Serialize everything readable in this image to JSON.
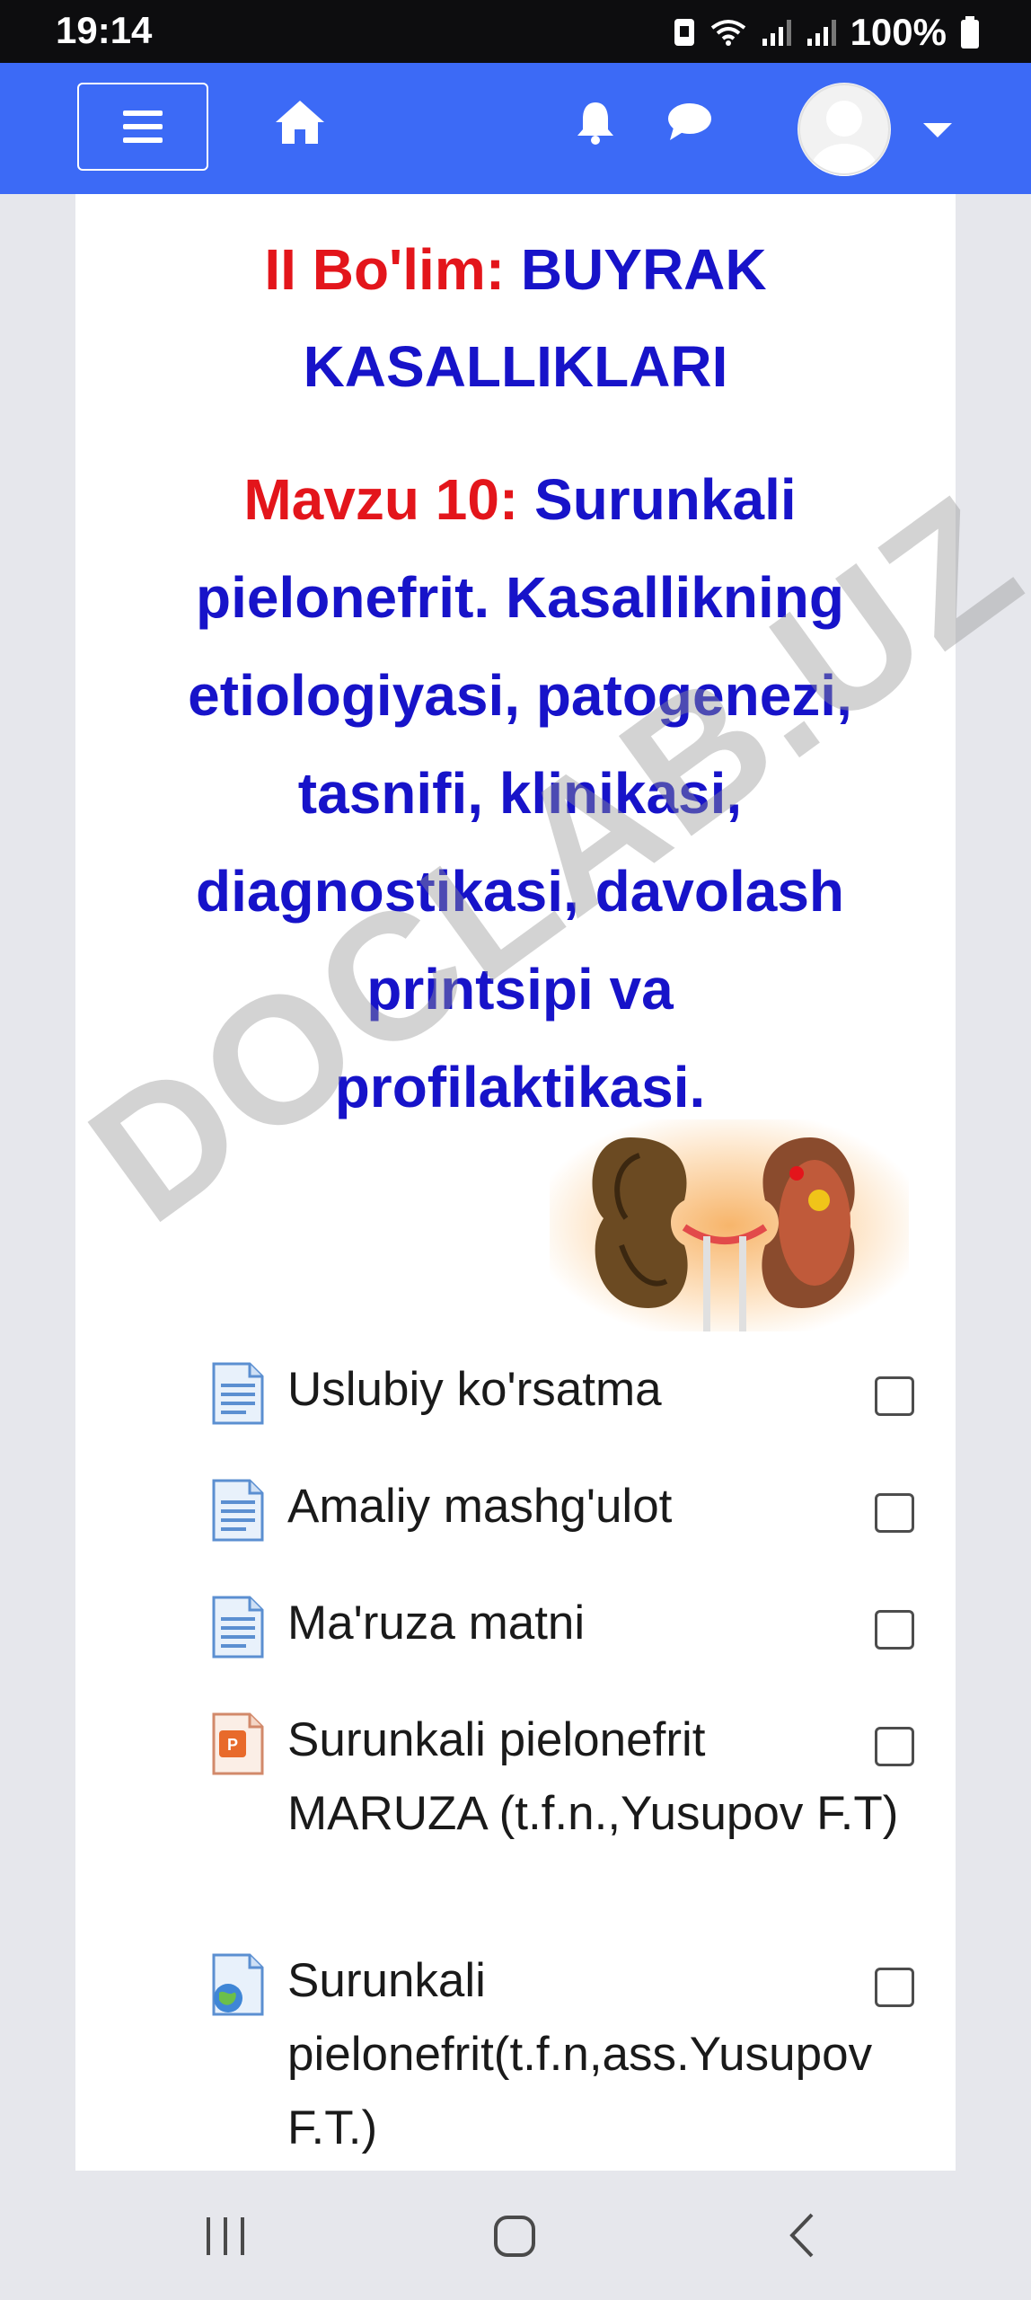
{
  "status_bar": {
    "time": "19:14",
    "battery": "100%"
  },
  "nav": {
    "menu_icon": "hamburger-icon",
    "home_icon": "home-icon",
    "notifications_icon": "bell-icon",
    "messages_icon": "chat-icon",
    "user_icon": "avatar",
    "dropdown_icon": "caret-down-icon",
    "bar_color": "#3c6af6"
  },
  "section": {
    "prefix": "II Bo'lim:",
    "title": "BUYRAK KASALLIKLARI"
  },
  "topic": {
    "prefix": "Mavzu 10:",
    "title": "Surunkali pielonefrit.  Kasallikning etiologiyasi, patogenezi, tasnifi, klinikasi, diagnostikasi, davolash printsipi va profilaktikasi."
  },
  "colors": {
    "accent_red": "#e3151b",
    "accent_blue": "#1713c9"
  },
  "resources": [
    {
      "label": "Uslubiy ko'rsatma",
      "icon": "document-icon"
    },
    {
      "label": "Amaliy mashg'ulot",
      "icon": "document-icon"
    },
    {
      "label": "Ma'ruza matni",
      "icon": "document-icon"
    },
    {
      "label": "Surunkali pielonefrit MARUZA (t.f.n.,Yusupov F.T)",
      "icon": "powerpoint-icon"
    },
    {
      "label": "Surunkali pielonefrit(t.f.n,ass.Yusupov F.T.)",
      "icon": "url-globe-icon"
    }
  ],
  "watermark": "DOCLAB.UZ",
  "system_nav": {
    "recents_icon": "recents-icon",
    "home_icon": "home-circle-icon",
    "back_icon": "back-icon"
  }
}
